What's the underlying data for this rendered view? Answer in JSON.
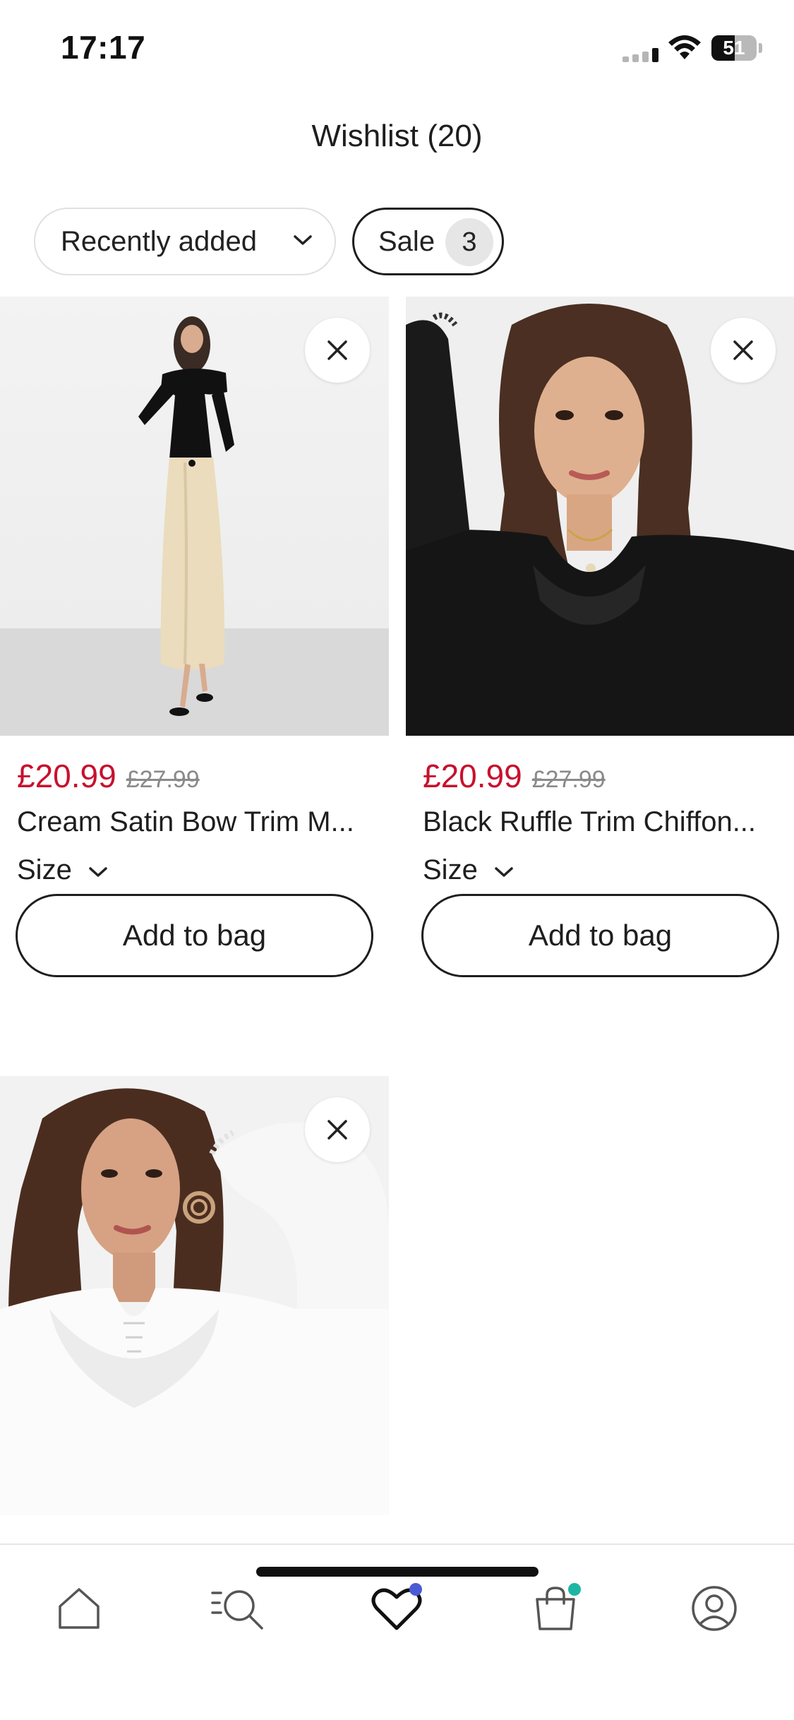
{
  "status_bar": {
    "time": "17:17",
    "battery_level": "51",
    "icons": [
      "cellular-signal-icon",
      "wifi-icon",
      "battery-icon"
    ]
  },
  "header": {
    "title": "Wishlist (20)"
  },
  "filters": {
    "sort_label": "Recently added",
    "sale_label": "Sale",
    "sale_count": "3"
  },
  "products": [
    {
      "price": "£20.99",
      "was_price": "£27.99",
      "name": "Cream Satin Bow Trim M...",
      "size_label": "Size",
      "add_label": "Add to bag"
    },
    {
      "price": "£20.99",
      "was_price": "£27.99",
      "name": "Black Ruffle Trim Chiffon...",
      "size_label": "Size",
      "add_label": "Add to bag"
    },
    {
      "price": "",
      "was_price": "",
      "name": "",
      "size_label": "",
      "add_label": ""
    }
  ],
  "bottom_nav": {
    "items": [
      {
        "icon": "home-icon",
        "active": false
      },
      {
        "icon": "search-list-icon",
        "active": false
      },
      {
        "icon": "heart-icon",
        "active": true
      },
      {
        "icon": "shopping-bag-icon",
        "active": false
      },
      {
        "icon": "account-icon",
        "active": false
      }
    ],
    "colors": {
      "wishlist_dot": "#4a5bd4",
      "bag_dot": "#1db6a4"
    }
  },
  "colors": {
    "sale_price": "#c8102e",
    "was_price": "#8a8a8a",
    "text": "#1e1e1e"
  }
}
